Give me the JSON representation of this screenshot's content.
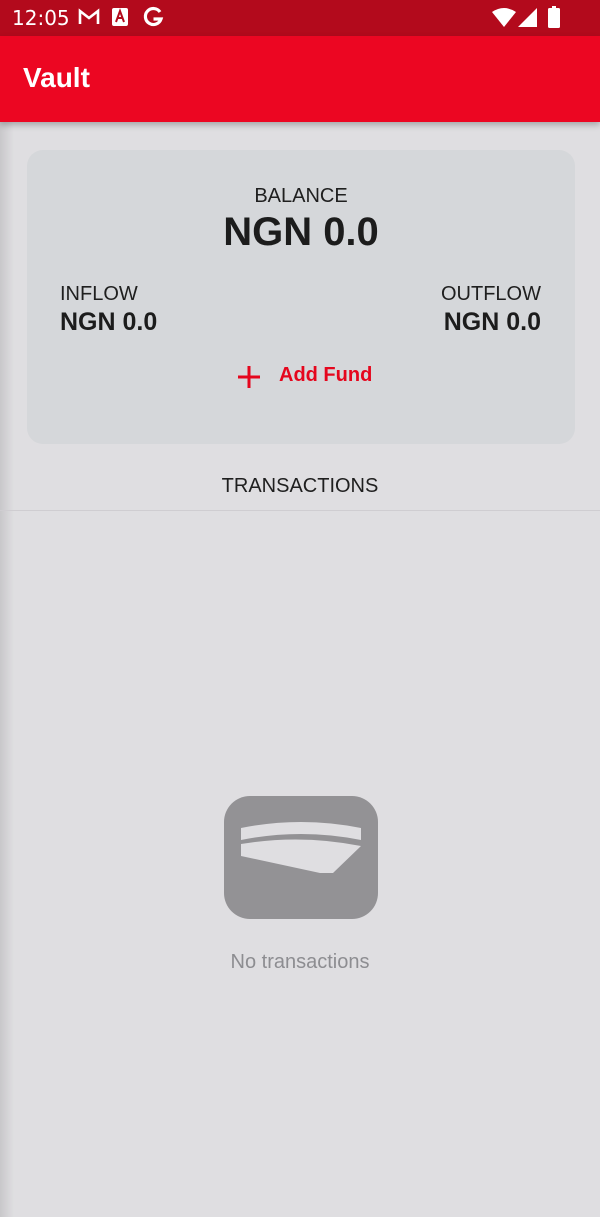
{
  "status_bar": {
    "time": "12:05",
    "left_icons": [
      "gmail-icon",
      "app-badge-icon",
      "google-icon"
    ],
    "right_icons": [
      "wifi-icon",
      "signal-icon",
      "battery-icon"
    ],
    "background": "#b30a1c"
  },
  "app_bar": {
    "title": "Vault",
    "background": "#ec0622"
  },
  "balance_card": {
    "balance_label": "BALANCE",
    "balance_value": "NGN 0.0",
    "inflow_label": "INFLOW",
    "inflow_value": "NGN 0.0",
    "outflow_label": "OUTFLOW",
    "outflow_value": "NGN 0.0",
    "add_fund_label": "Add Fund",
    "add_fund_icon": "plus-icon",
    "accent_color": "#e5061d"
  },
  "transactions": {
    "header": "TRANSACTIONS",
    "empty_icon": "wallet-icon",
    "empty_text": "No transactions"
  }
}
